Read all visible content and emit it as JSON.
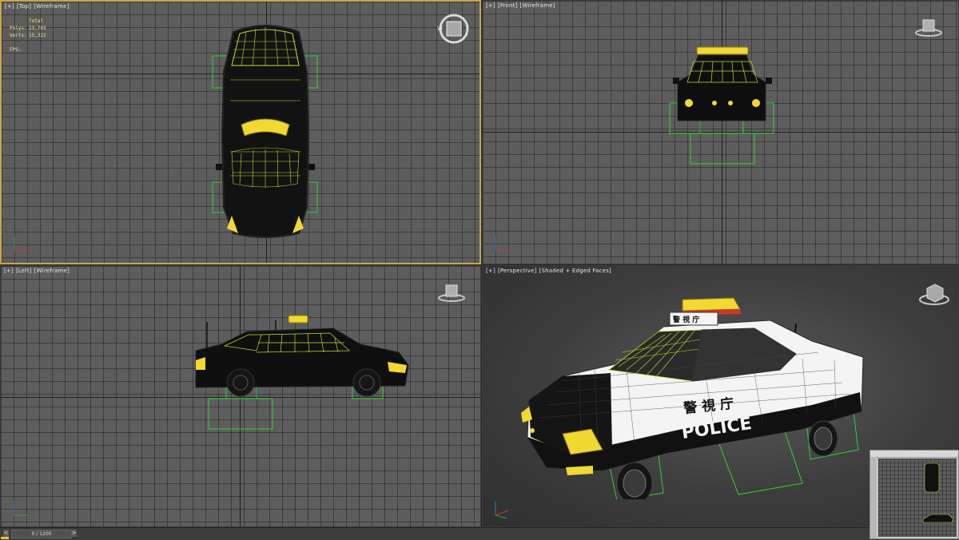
{
  "viewports": {
    "top": {
      "labels": [
        "[+]",
        "[Top]",
        "[Wireframe]"
      ]
    },
    "front": {
      "labels": [
        "[+]",
        "[Front]",
        "[Wireframe]"
      ]
    },
    "left": {
      "labels": [
        "[+]",
        "[Left]",
        "[Wireframe]"
      ]
    },
    "perspective": {
      "labels": [
        "[+]",
        "[Perspective]",
        "[Shaded + Edged Faces]"
      ]
    }
  },
  "stats": {
    "header": "Total",
    "polys_label": "Polys:",
    "polys_value": "13,703",
    "verts_label": "Verts:",
    "verts_value": "15,322",
    "fps_label": "FPS:"
  },
  "car_text": {
    "police": "POLICE",
    "kanji": "警 視 庁",
    "roof_sign": "警 視 庁"
  },
  "timeline": {
    "frame": "0 / 1200",
    "prev": "<",
    "next": ">"
  },
  "colors": {
    "selection": "#2fd12f",
    "wire_highlight": "#b8e02a",
    "yellow": "#f1d832",
    "active_border": "#c8a848"
  }
}
